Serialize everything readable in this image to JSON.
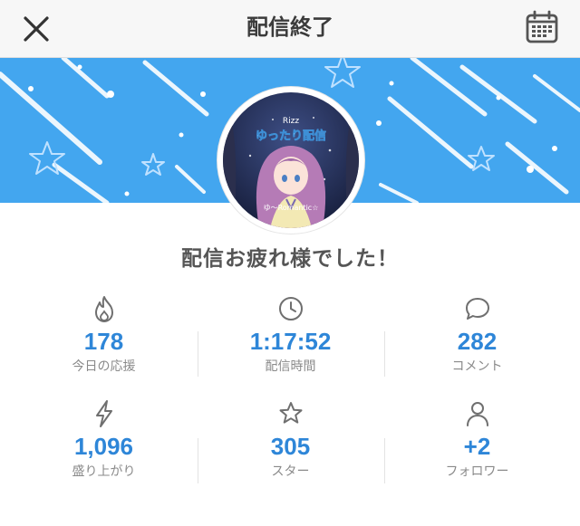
{
  "header": {
    "title": "配信終了",
    "close_icon": "close-icon",
    "calendar_icon": "calendar-icon"
  },
  "banner": {
    "color": "#43a6ef",
    "avatar": {
      "top_text": "Rizz",
      "title_text": "ゆったり配信",
      "bottom_text": "ゆ〜Romantic☆"
    }
  },
  "headline": "配信お疲れ様でした！",
  "stats": [
    {
      "icon": "fire-icon",
      "value": "178",
      "label": "今日の応援"
    },
    {
      "icon": "clock-icon",
      "value": "1:17:52",
      "label": "配信時間"
    },
    {
      "icon": "comment-icon",
      "value": "282",
      "label": "コメント"
    },
    {
      "icon": "lightning-icon",
      "value": "1,096",
      "label": "盛り上がり"
    },
    {
      "icon": "star-icon",
      "value": "305",
      "label": "スター"
    },
    {
      "icon": "person-icon",
      "value": "+2",
      "label": "フォロワー"
    }
  ],
  "colors": {
    "accent_value": "#2e86d8",
    "label_gray": "#8a8a8a",
    "icon_gray": "#6f6f6f"
  }
}
